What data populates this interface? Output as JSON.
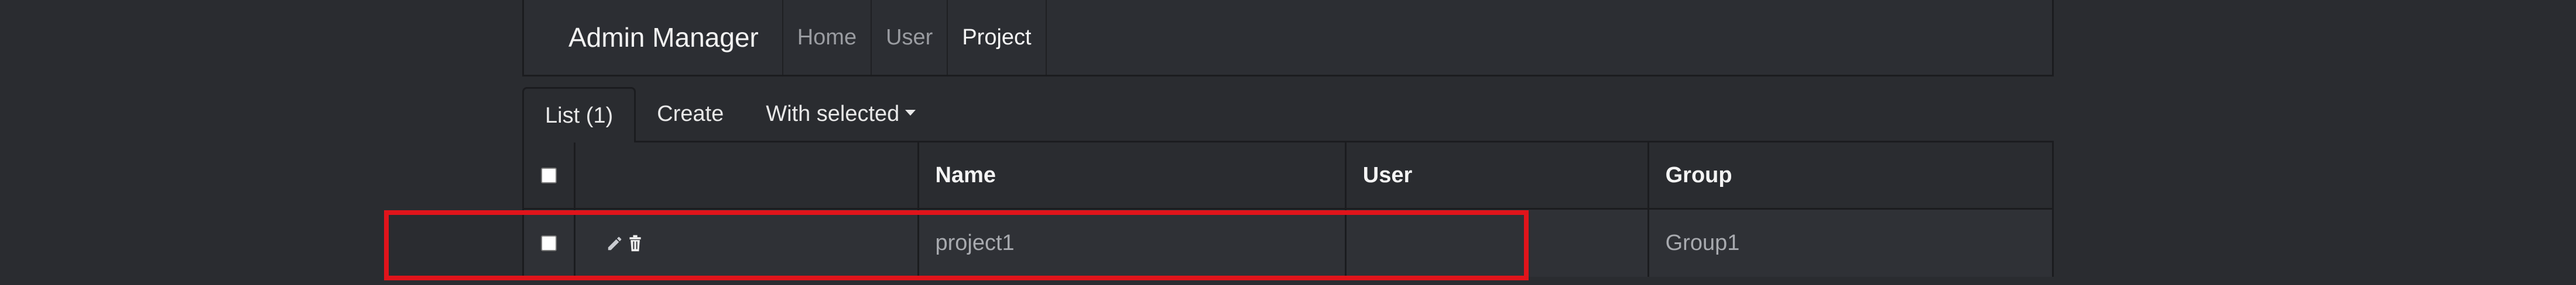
{
  "navbar": {
    "brand": "Admin Manager",
    "links": [
      {
        "label": "Home",
        "active": false
      },
      {
        "label": "User",
        "active": false
      },
      {
        "label": "Project",
        "active": true
      }
    ]
  },
  "tabs": {
    "list_label": "List (1)",
    "create_label": "Create",
    "with_selected_label": "With selected"
  },
  "table": {
    "columns": [
      "",
      "",
      "Name",
      "User",
      "Group"
    ],
    "rows": [
      {
        "name": "project1",
        "user": "",
        "group": "Group1"
      }
    ]
  },
  "icons": {
    "edit": "pencil-icon",
    "delete": "trash-icon"
  },
  "colors": {
    "background": "#2a2c30",
    "highlight": "#e0141b"
  }
}
